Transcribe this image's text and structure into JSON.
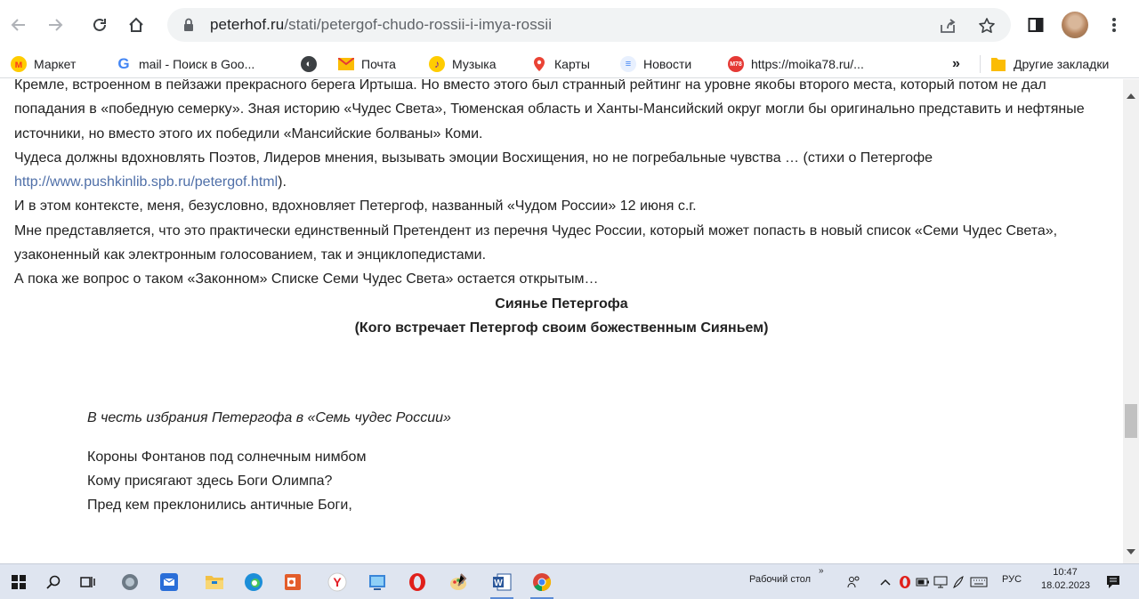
{
  "browser": {
    "url_host": "peterhof.ru",
    "url_path": "/stati/petergof-chudo-rossii-i-imya-rossii"
  },
  "bookmarks": [
    {
      "label": "Маркет",
      "icon": "yandex-market-icon",
      "color": "#fc3f1d"
    },
    {
      "label": "mail - Поиск в Goo...",
      "icon": "google-icon",
      "color": "#4285f4"
    },
    {
      "label": "",
      "icon": "globe-icon",
      "color": "#202124"
    },
    {
      "label": "Почта",
      "icon": "mail-icon",
      "color": "#fbbc04"
    },
    {
      "label": "Музыка",
      "icon": "music-icon",
      "color": "#ff9800"
    },
    {
      "label": "Карты",
      "icon": "maps-pin-icon",
      "color": "#ea4335"
    },
    {
      "label": "Новости",
      "icon": "news-icon",
      "color": "#4285f4"
    },
    {
      "label": "https://moika78.ru/...",
      "icon": "moika78-icon",
      "color": "#e53935",
      "badge": "M78"
    }
  ],
  "bookmarks_overflow": "»",
  "other_bookmarks": "Другие закладки",
  "article": {
    "para1_partial": "Кремле, встроенном в пейзажи прекрасного берега Иртыша. Но вместо этого был странный рейтинг на уровне якобы второго места, который потом не дал попадания в «победную семерку». Зная историю «Чудес Света», Тюменская область и Ханты-Мансийский округ могли бы оригинально представить и нефтяные источники, но вместо этого их победили «Мансийские болваны» Коми.",
    "para2_text": "Чудеса должны вдохновлять Поэтов, Лидеров мнения, вызывать эмоции Восхищения, но не погребальные чувства … (стихи о Петергофе ",
    "para2_link": "http://www.pushkinlib.spb.ru/petergof.html",
    "para2_tail": ").",
    "para3": "И в этом контексте, меня, безусловно, вдохновляет Петергоф, названный «Чудом России» 12 июня с.г.",
    "para4": "Мне представляется, что это практически единственный Претендент из перечня Чудес России, который может попасть в новый список «Семи Чудес Света», узаконенный как электронным голосованием, так и энциклопедистами.",
    "para5": "А пока же вопрос о таком «Законном» Списке Семи Чудес Света» остается открытым…",
    "heading1": "Сиянье Петергофа",
    "heading2": "(Кого встречает Петергоф своим божественным Сияньем)",
    "epigraph": "В честь избрания Петергофа в «Семь чудес России»",
    "poem_lines": [
      "Короны Фонтанов под солнечным нимбом",
      "Кому присягают здесь Боги Олимпа?",
      "Пред кем преклонились античные Боги,"
    ]
  },
  "scrollbar": {
    "position_fraction": 0.74
  },
  "taskbar": {
    "desktop_label": "Рабочий стол",
    "lang": "РУС",
    "time": "10:47",
    "date": "18.02.2023"
  }
}
